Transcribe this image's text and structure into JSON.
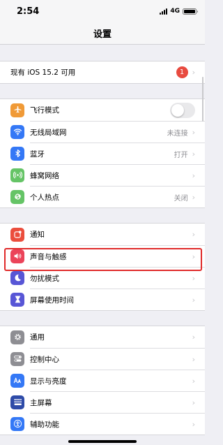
{
  "status_bar": {
    "time": "2:54",
    "network": "4G"
  },
  "nav": {
    "title": "设置"
  },
  "update": {
    "label": "现有 iOS 15.2 可用",
    "badge": "1"
  },
  "group1": [
    {
      "name": "airplane-mode",
      "label": "飞行模式",
      "icon": "airplane-icon",
      "color": "#f09a37",
      "value": "",
      "toggle": true
    },
    {
      "name": "wlan",
      "label": "无线局域网",
      "icon": "wifi-icon",
      "color": "#3478f6",
      "value": "未连接"
    },
    {
      "name": "bluetooth",
      "label": "蓝牙",
      "icon": "bluetooth-icon",
      "color": "#3478f6",
      "value": "打开"
    },
    {
      "name": "cellular",
      "label": "蜂窝网络",
      "icon": "antenna-icon",
      "color": "#65c466",
      "value": ""
    },
    {
      "name": "hotspot",
      "label": "个人热点",
      "icon": "hotspot-icon",
      "color": "#65c466",
      "value": "关闭"
    }
  ],
  "group2": [
    {
      "name": "notifications",
      "label": "通知",
      "icon": "notification-icon",
      "color": "#eb4e3d"
    },
    {
      "name": "sounds-haptics",
      "label": "声音与触感",
      "icon": "speaker-icon",
      "color": "#eb445a"
    },
    {
      "name": "do-not-disturb",
      "label": "勿扰模式",
      "icon": "moon-icon",
      "color": "#5856d6"
    },
    {
      "name": "screen-time",
      "label": "屏幕使用时间",
      "icon": "hourglass-icon",
      "color": "#5856d6"
    }
  ],
  "group3": [
    {
      "name": "general",
      "label": "通用",
      "icon": "gear-icon",
      "color": "#8e8e93"
    },
    {
      "name": "control-center",
      "label": "控制中心",
      "icon": "switches-icon",
      "color": "#8e8e93"
    },
    {
      "name": "display-brightness",
      "label": "显示与亮度",
      "icon": "aa-icon",
      "color": "#3478f6"
    },
    {
      "name": "home-screen",
      "label": "主屏幕",
      "icon": "grid-icon",
      "color": "#2e4ba8"
    },
    {
      "name": "accessibility",
      "label": "辅助功能",
      "icon": "accessibility-icon",
      "color": "#3478f6"
    }
  ]
}
